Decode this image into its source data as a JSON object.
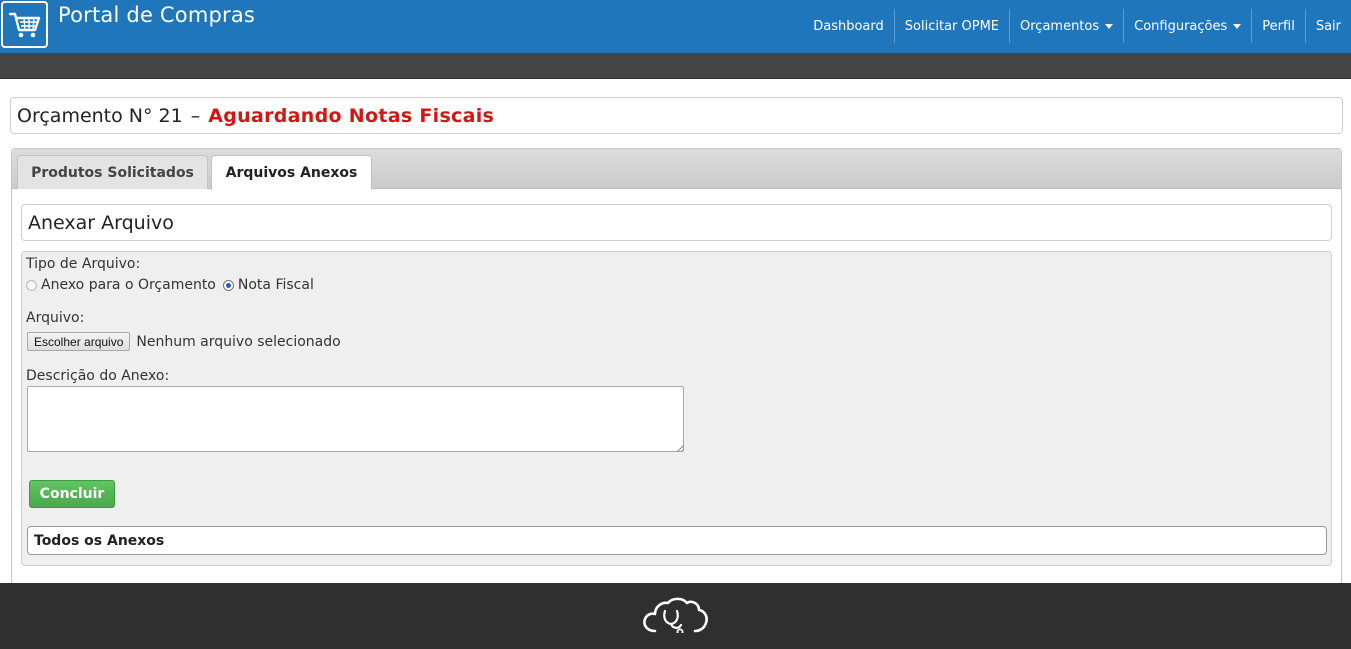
{
  "header": {
    "brand": "Portal de Compras",
    "logo_icon": "shopping-cart-icon",
    "nav": [
      {
        "label": "Dashboard",
        "dropdown": false
      },
      {
        "label": "Solicitar OPME",
        "dropdown": false
      },
      {
        "label": "Orçamentos",
        "dropdown": true
      },
      {
        "label": "Configurações",
        "dropdown": true
      },
      {
        "label": "Perfil",
        "dropdown": false
      },
      {
        "label": "Sair",
        "dropdown": false
      }
    ]
  },
  "page": {
    "title_prefix": "Orçamento N° 21",
    "title_separator": "–",
    "status": "Aguardando Notas Fiscais",
    "status_color": "#d21515"
  },
  "tabs": [
    {
      "label": "Produtos Solicitados",
      "active": false
    },
    {
      "label": "Arquivos Anexos",
      "active": true
    }
  ],
  "form": {
    "heading": "Anexar Arquivo",
    "file_type_label": "Tipo de Arquivo:",
    "file_type_options": [
      {
        "label": "Anexo para o Orçamento",
        "checked": false
      },
      {
        "label": "Nota Fiscal",
        "checked": true
      }
    ],
    "file_label": "Arquivo:",
    "file_button": "Escolher arquivo",
    "file_status": "Nenhum arquivo selecionado",
    "description_label": "Descrição do Anexo:",
    "description_value": "",
    "submit_label": "Concluir",
    "submit_color": "#5cb85c"
  },
  "attachments": {
    "heading": "Todos os Anexos"
  },
  "footer": {
    "icon": "cloud-stethoscope-icon"
  },
  "colors": {
    "header_bg": "#1f76bb",
    "band_bg": "#454545",
    "footer_bg": "#2f2f2f"
  }
}
